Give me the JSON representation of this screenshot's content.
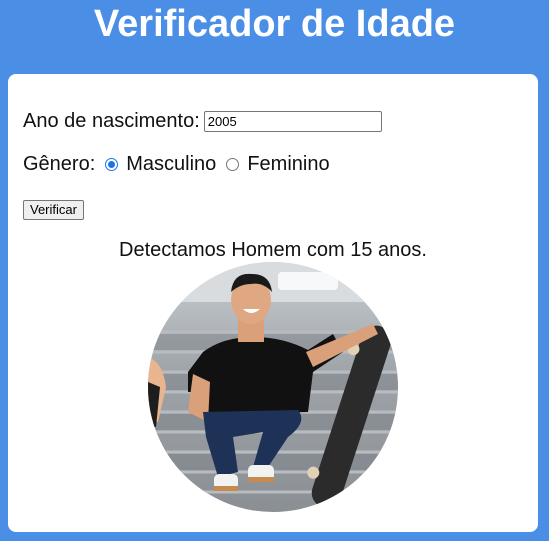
{
  "header": {
    "title": "Verificador de Idade"
  },
  "form": {
    "year_label": "Ano de nascimento:",
    "year_value": "2005",
    "gender_label": "Gênero:",
    "gender_options": [
      "Masculino",
      "Feminino"
    ],
    "gender_selected": "Masculino",
    "verify_button": "Verificar"
  },
  "result": {
    "text": "Detectamos Homem com 15 anos."
  },
  "colors": {
    "page_background": "#4a8ee6",
    "card_background": "#ffffff",
    "radio_accent": "#1a73e8"
  }
}
